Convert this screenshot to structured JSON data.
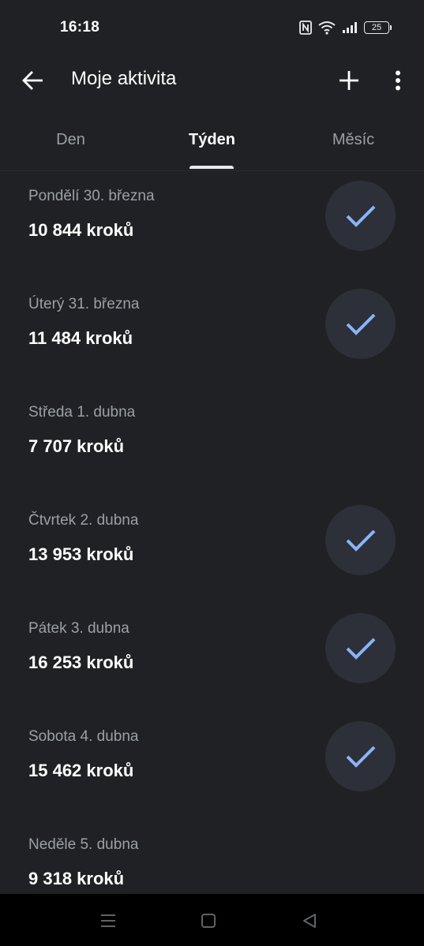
{
  "status_bar": {
    "time": "16:18",
    "battery": "25",
    "icons": [
      "nfc-icon",
      "wifi-icon",
      "signal-icon",
      "battery-icon"
    ]
  },
  "app_bar": {
    "title": "Moje aktivita",
    "icons": [
      "arrow-back-icon",
      "plus-icon",
      "more-vertical-icon"
    ]
  },
  "tabs": [
    {
      "label": "Den",
      "active": false
    },
    {
      "label": "Týden",
      "active": true
    },
    {
      "label": "Měsíc",
      "active": false
    }
  ],
  "days": [
    {
      "date": "Pondělí 30. března",
      "steps": "10 844 kroků",
      "goal_met": true
    },
    {
      "date": "Úterý 31. března",
      "steps": "11 484 kroků",
      "goal_met": true
    },
    {
      "date": "Středa 1. dubna",
      "steps": "7 707 kroků",
      "goal_met": false
    },
    {
      "date": "Čtvrtek 2. dubna",
      "steps": "13 953 kroků",
      "goal_met": true
    },
    {
      "date": "Pátek 3. dubna",
      "steps": "16 253 kroků",
      "goal_met": true
    },
    {
      "date": "Sobota 4. dubna",
      "steps": "15 462 kroků",
      "goal_met": true
    },
    {
      "date": "Neděle 5. dubna",
      "steps": "9 318 kroků",
      "goal_met": false
    }
  ],
  "nav_bar": {
    "icons": [
      "menu-icon",
      "home-square-icon",
      "back-triangle-icon"
    ]
  },
  "colors": {
    "background": "#202124",
    "check_accent": "#8ab4f8",
    "badge_bg": "#2d3039",
    "secondary_text": "#9aa0a6"
  }
}
